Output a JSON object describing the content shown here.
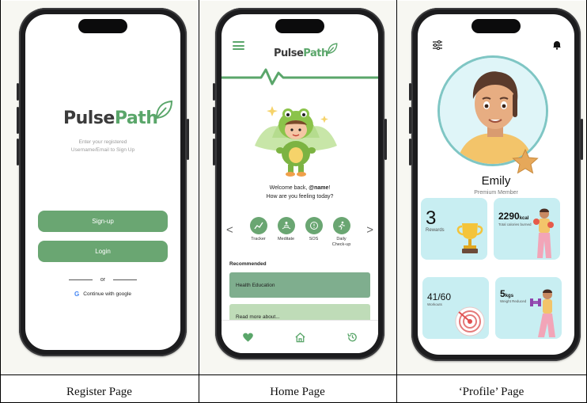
{
  "captions": {
    "register": "Register Page",
    "home": "Home Page",
    "profile": "‘Profile’ Page"
  },
  "logo": {
    "part1": "Pulse",
    "part2": "Path"
  },
  "register": {
    "subtitle_line1": "Enter your registered",
    "subtitle_line2": "Username/Email to Sign Up",
    "signup_label": "Sign-up",
    "login_label": "Login",
    "or_label": "or",
    "google_label": "Continue with google"
  },
  "home": {
    "welcome_line1_prefix": "Welcome back, ",
    "welcome_name": "@name",
    "welcome_line1_suffix": "!",
    "welcome_line2": "How are you feeling today?",
    "quick_actions": [
      {
        "icon": "chart-icon",
        "label": "Tracker"
      },
      {
        "icon": "meditate-icon",
        "label": "Meditate"
      },
      {
        "icon": "sos-icon",
        "label": "SOS"
      },
      {
        "icon": "run-icon",
        "label": "Daily\nCheck-up"
      }
    ],
    "recommended_title": "Recommended",
    "recommended": [
      {
        "label": "Health Education"
      },
      {
        "label": "Read more about..."
      }
    ],
    "nav": [
      "heart-icon",
      "home-icon",
      "history-icon"
    ]
  },
  "profile": {
    "name": "Emily",
    "subtitle": "Premium Member",
    "stats": {
      "rewards_value": "3",
      "rewards_label": "Rewards",
      "kcal_value": "2290",
      "kcal_unit": "kcal",
      "kcal_label": "Total calories burned",
      "workouts_value": "41/60",
      "workouts_label": "Workouts",
      "weight_value": "5",
      "weight_unit": "kgs",
      "weight_label": "Weight Reduced"
    }
  },
  "colors": {
    "brand_green": "#6aa672",
    "logo_dark": "#3b3b3b",
    "card_teal": "#c8eef2",
    "rec_card_1": "#7fae8e",
    "rec_card_2": "#bfdcb8"
  }
}
